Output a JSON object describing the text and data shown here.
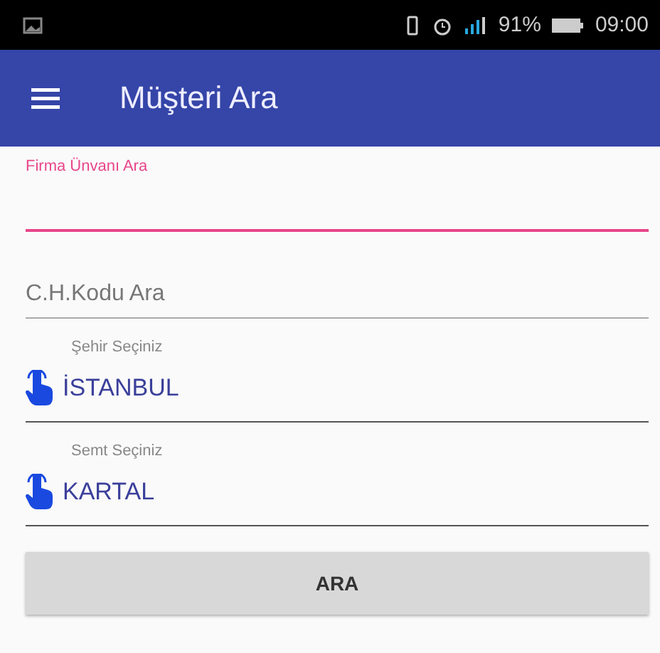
{
  "status_bar": {
    "battery": "91%",
    "time": "09:00"
  },
  "app_bar": {
    "title": "Müşteri Ara"
  },
  "text_fields": [
    {
      "label": "Firma Ünvanı Ara",
      "focused": true
    },
    {
      "placeholder": "C.H.Kodu Ara",
      "focused": false
    }
  ],
  "pickers": [
    {
      "label": "Şehir Seçiniz",
      "value": "İSTANBUL"
    },
    {
      "label": "Semt Seçiniz",
      "value": "KARTAL"
    }
  ],
  "search_button": {
    "label": "ARA"
  }
}
